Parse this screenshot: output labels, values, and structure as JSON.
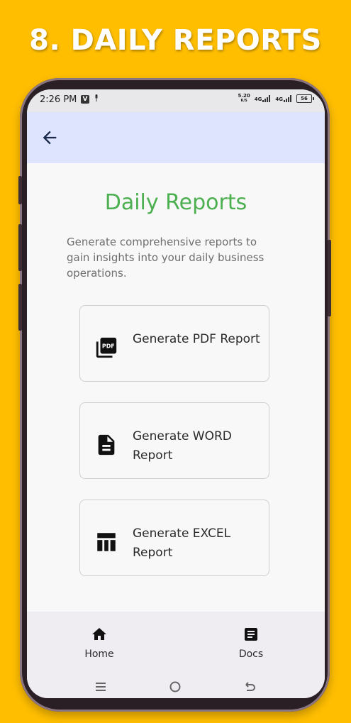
{
  "banner": {
    "title": "8. DAILY REPORTS"
  },
  "statusbar": {
    "time": "2:26 PM",
    "net_speed_value": "5.20",
    "net_speed_unit": "K/S",
    "signal1_label": "4G",
    "signal2_label": "4G",
    "battery_level": "56",
    "app_icon": "v-app-icon",
    "mic_icon": "mic-icon"
  },
  "appbar": {
    "back_icon": "back-arrow-icon"
  },
  "page": {
    "title": "Daily Reports",
    "description": "Generate comprehensive reports to gain insights into your daily business operations.",
    "title_color": "#4CAF50"
  },
  "reports": [
    {
      "label": "Generate PDF Report",
      "icon": "pdf-icon"
    },
    {
      "label": "Generate WORD Report",
      "icon": "document-icon"
    },
    {
      "label": "Generate EXCEL Report",
      "icon": "table-icon"
    }
  ],
  "bottom_nav": {
    "items": [
      {
        "label": "Home",
        "icon": "home-icon"
      },
      {
        "label": "Docs",
        "icon": "docs-icon"
      }
    ]
  },
  "system_nav": {
    "buttons": [
      "menu-icon",
      "home-circle-icon",
      "back-icon"
    ]
  },
  "colors": {
    "background": "#FFBE00",
    "appbar": "#DFE4FE",
    "accent_green": "#4CAF50"
  }
}
